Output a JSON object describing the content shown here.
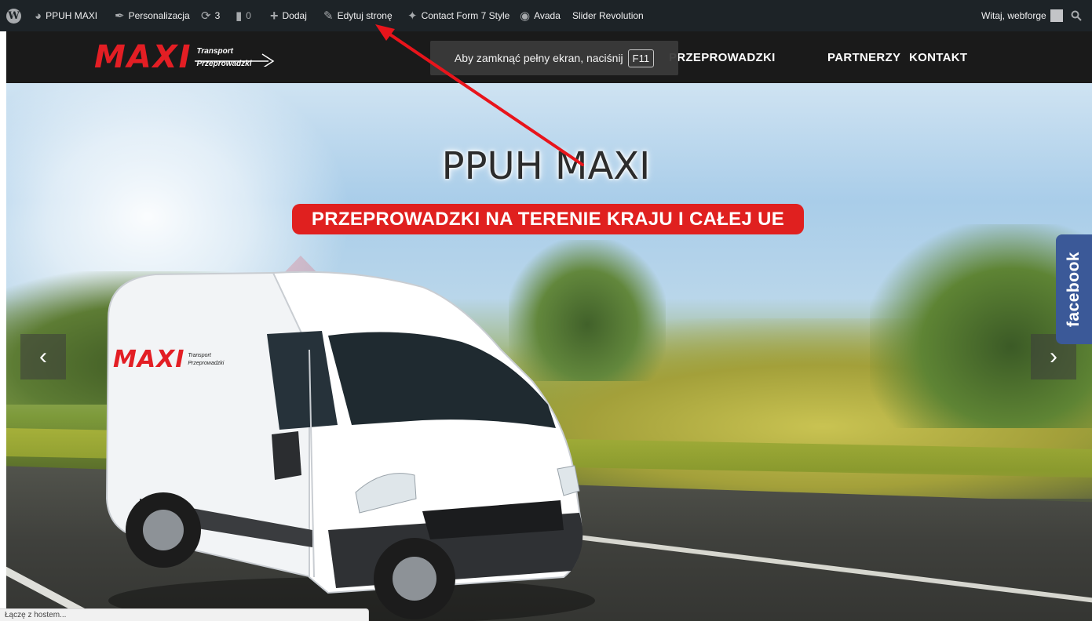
{
  "adminbar": {
    "site_name": "PPUH MAXI",
    "customize": "Personalizacja",
    "updates_count": "3",
    "comments_count": "0",
    "add_new": "Dodaj",
    "edit_page": "Edytuj stronę",
    "cf7_style": "Contact Form 7 Style",
    "avada": "Avada",
    "slider_revolution": "Slider Revolution",
    "greeting": "Witaj, webforge"
  },
  "logo": {
    "brand": "MAXI",
    "line1": "Transport",
    "line2": "Przeprowadzki"
  },
  "nav": {
    "items": [
      "PRZEPROWADZKI",
      "PARTNERZY",
      "KONTAKT"
    ]
  },
  "fullscreen_notice": {
    "text": "Aby zamknąć pełny ekran, naciśnij",
    "key": "F11"
  },
  "hero": {
    "title": "PPUH MAXI",
    "subtitle": "PRZEPROWADZKI NA TERENIE KRAJU I CAŁEJ UE",
    "prev_symbol": "‹",
    "next_symbol": "›",
    "van_logo": {
      "brand": "MAXI",
      "line1": "Transport",
      "line2": "Przeprowadzki"
    }
  },
  "facebook_tab": "facebook",
  "status_bar": "Łączę z hostem...",
  "colors": {
    "adminbar_bg": "#1d2327",
    "header_bg": "#1a1a1a",
    "brand_red": "#e31e24",
    "subtitle_bg": "#e0201f",
    "facebook_blue": "#3b5998",
    "annotation_arrow": "#e8141b"
  },
  "icons": {
    "wp_logo": "wordpress-icon",
    "site": "dashboard-icon",
    "customize": "paintbrush-icon",
    "updates": "refresh-icon",
    "comments": "comment-icon",
    "add": "plus-icon",
    "edit": "pencil-icon",
    "cf7": "bird-icon",
    "avada": "avada-icon",
    "search": "search-icon"
  }
}
